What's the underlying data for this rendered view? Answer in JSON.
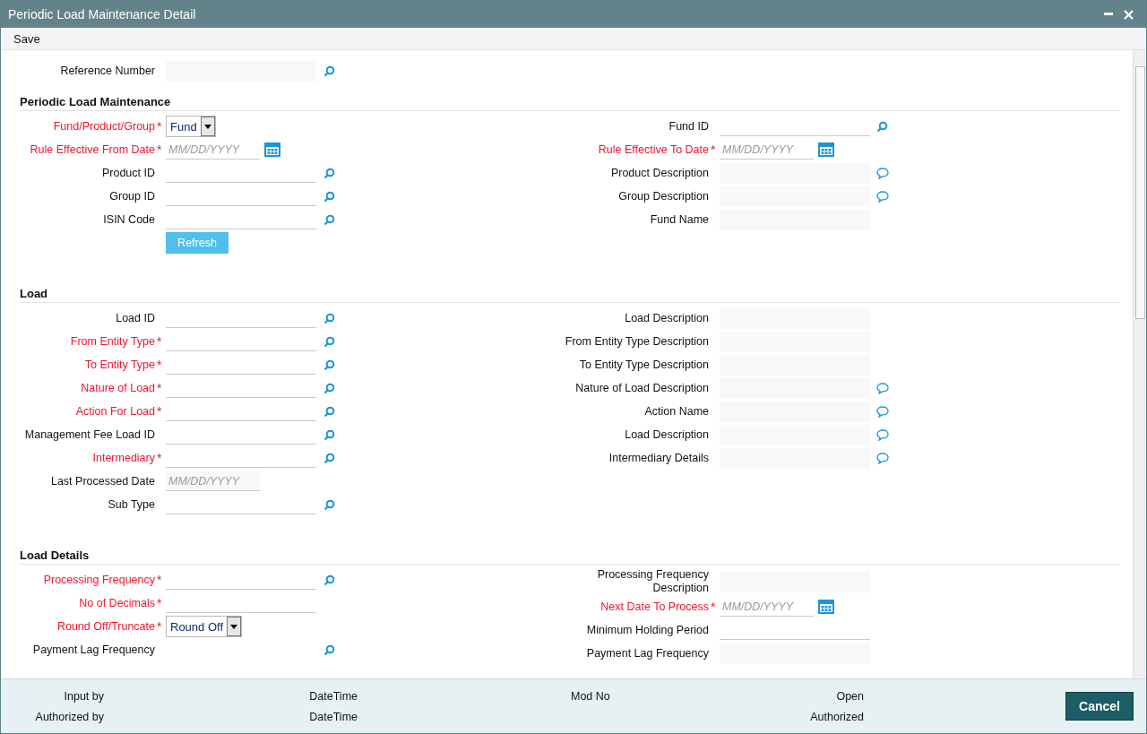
{
  "window": {
    "title": "Periodic Load Maintenance Detail"
  },
  "toolbar": [
    "Save"
  ],
  "reference": {
    "label": "Reference Number",
    "kind": "lookup_display",
    "required": false
  },
  "sections": [
    {
      "title": "Periodic Load Maintenance",
      "left": [
        {
          "label": "Fund/Product/Group",
          "required": true,
          "marker": "*",
          "kind": "select",
          "value": "Fund"
        },
        {
          "label": "Rule Effective From Date",
          "required": true,
          "marker": "*",
          "kind": "date",
          "placeholder": "MM/DD/YYYY"
        },
        {
          "label": "Product ID",
          "required": false,
          "kind": "lookup"
        },
        {
          "label": "Group ID",
          "required": false,
          "kind": "lookup"
        },
        {
          "label": "ISIN Code",
          "required": false,
          "kind": "lookup"
        },
        {
          "label": "Refresh",
          "kind": "button"
        }
      ],
      "right": [
        {
          "label": "Fund ID",
          "required": false,
          "kind": "lookup"
        },
        {
          "label": "Rule Effective To Date",
          "required": true,
          "marker": "*",
          "kind": "date",
          "placeholder": "MM/DD/YYYY"
        },
        {
          "label": "Product Description",
          "required": false,
          "kind": "display_note"
        },
        {
          "label": "Group Description",
          "required": false,
          "kind": "display_note"
        },
        {
          "label": "Fund Name",
          "required": false,
          "kind": "display"
        }
      ]
    },
    {
      "title": "Load",
      "left": [
        {
          "label": "Load ID",
          "required": false,
          "kind": "lookup"
        },
        {
          "label": "From Entity Type",
          "required": true,
          "marker": "*",
          "kind": "lookup"
        },
        {
          "label": "To Entity Type",
          "required": true,
          "marker": "*",
          "kind": "lookup"
        },
        {
          "label": "Nature of Load",
          "required": true,
          "marker": "*",
          "kind": "lookup"
        },
        {
          "label": "Action For Load",
          "required": true,
          "marker": "*",
          "kind": "lookup"
        },
        {
          "label": "Management Fee Load ID",
          "required": false,
          "kind": "lookup"
        },
        {
          "label": "Intermediary",
          "required": true,
          "marker": "*",
          "kind": "lookup"
        },
        {
          "label": "Last Processed Date",
          "required": false,
          "kind": "date_display",
          "placeholder": "MM/DD/YYYY"
        },
        {
          "label": "Sub Type",
          "required": false,
          "kind": "lookup"
        }
      ],
      "right": [
        {
          "label": "Load Description",
          "required": false,
          "kind": "display"
        },
        {
          "label": "From Entity Type Description",
          "required": false,
          "kind": "display"
        },
        {
          "label": "To Entity Type Description",
          "required": false,
          "kind": "display"
        },
        {
          "label": "Nature of Load Description",
          "required": false,
          "kind": "display_note"
        },
        {
          "label": "Action Name",
          "required": false,
          "kind": "display_note"
        },
        {
          "label": "Load Description",
          "required": false,
          "kind": "display_note"
        },
        {
          "label": "Intermediary Details",
          "required": false,
          "kind": "display_note"
        }
      ]
    },
    {
      "title": "Load Details",
      "left": [
        {
          "label": "Processing Frequency",
          "required": true,
          "marker": "*",
          "kind": "lookup"
        },
        {
          "label": "No of Decimals",
          "required": true,
          "marker": "*",
          "kind": "text"
        },
        {
          "label": "Round Off/Truncate",
          "required": true,
          "marker": "*",
          "kind": "select",
          "value": "Round Off"
        },
        {
          "label": "Payment Lag Frequency",
          "required": false,
          "kind": "lookup_bare"
        }
      ],
      "right": [
        {
          "label": "Processing Frequency Description",
          "required": false,
          "kind": "display"
        },
        {
          "label": "Next Date To Process",
          "required": true,
          "marker": "*",
          "kind": "date",
          "placeholder": "MM/DD/YYYY"
        },
        {
          "label": "Minimum Holding Period",
          "required": false,
          "kind": "text"
        },
        {
          "label": "Payment Lag Frequency",
          "required": false,
          "kind": "display"
        }
      ]
    }
  ],
  "footer": [
    [
      {
        "kind": "user",
        "text": "Input by"
      },
      {
        "kind": "datetime",
        "text": "DateTime"
      },
      {
        "kind": "mod",
        "text": "Mod No"
      },
      {
        "kind": "status",
        "text": "Open"
      }
    ],
    [
      {
        "kind": "user",
        "text": "Authorized by"
      },
      {
        "kind": "datetime",
        "text": "DateTime"
      },
      {
        "kind": "status",
        "text": "Authorized"
      }
    ]
  ],
  "cancel": "Cancel"
}
